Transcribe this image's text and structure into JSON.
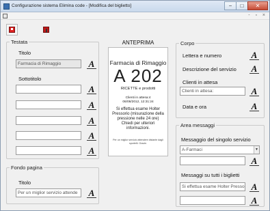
{
  "window": {
    "title": "Configurazione sistema Elimina code - [Modifica del biglietto]",
    "controls": {
      "minimize": "−",
      "maximize": "□",
      "close": "✕"
    },
    "mdi_controls": "- ▫ ×"
  },
  "toolbar": {
    "save_icon": "save-icon",
    "exit_icon": "exit-icon"
  },
  "testata": {
    "legend": "Testata",
    "titolo_label": "Titolo",
    "titolo_value": "Farmacia di Rimaggio",
    "sottotitolo_label": "Sottotitolo",
    "sottotitolo_values": [
      "",
      "",
      "",
      "",
      ""
    ]
  },
  "fondo": {
    "legend": "Fondo pagina",
    "titolo_label": "Titolo",
    "titolo_value": "Per un miglior servizio attende"
  },
  "preview": {
    "heading": "ANTEPRIMA",
    "name": "Farmacia di Rimaggio",
    "number": "A 202",
    "service": "RICETTE e prodotti",
    "waiting_line1": "Clienti in attesa:4",
    "waiting_line2": "06/08/2012, 12:31:24",
    "message": "Si effettua esame Holter Pressorio (misurazione della pressione nelle 24 ore) Chiedi per ulteriori informazioni.",
    "footer": "Per un miglior servizio attendere distante dagli sportelli. Grazie."
  },
  "corpo": {
    "legend": "Corpo",
    "lettera_label": "Lettera e numero",
    "descrizione_label": "Descrizione del servizio",
    "clienti_label": "Clienti in attesa",
    "clienti_value": "Clienti in attesa:",
    "data_label": "Data e ora"
  },
  "messaggi": {
    "legend": "Area messaggi",
    "singolo_label": "Messaggio del singolo servizio",
    "singolo_select": "A-Farmaci",
    "singolo_value": "",
    "tutti_label": "Messaggi su tutti i biglietti",
    "tutti_value": "Si effettua esame Holter Presso",
    "tutti_extra_value": ""
  },
  "font_button_glyph": "A"
}
